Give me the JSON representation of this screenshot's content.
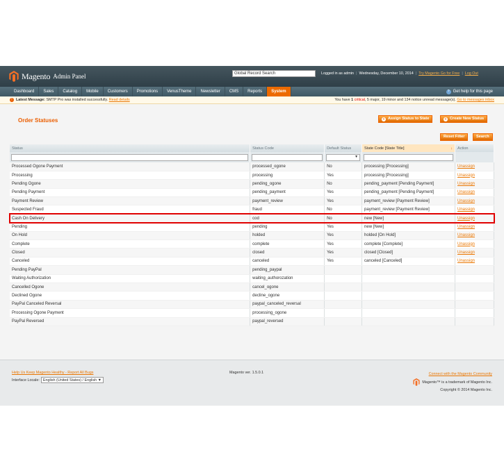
{
  "header": {
    "logo_text": "Magento",
    "logo_sub": "Admin Panel",
    "search_placeholder": "Global Record Search",
    "logged_in": "Logged in as admin",
    "date": "Wednesday, December 10, 2014",
    "try_link": "Try Magento Go for Free",
    "logout": "Log Out"
  },
  "nav": {
    "items": [
      "Dashboard",
      "Sales",
      "Catalog",
      "Mobile",
      "Customers",
      "Promotions",
      "VenusTheme",
      "Newsletter",
      "CMS",
      "Reports",
      "System"
    ],
    "active": "System",
    "help": "Get help for this page"
  },
  "message": {
    "label": "Latest Message:",
    "text": "SMTP Pro was installed successfully.",
    "link": "Read details",
    "right_prefix": "You have",
    "critical_count": "1",
    "critical_word": "critical",
    "rest": ", 5 major, 19 minor and 134 notice unread message(s).",
    "inbox_link": "Go to messages inbox"
  },
  "page": {
    "title": "Order Statuses",
    "assign_button": "Assign Status to State",
    "create_button": "Create New Status",
    "reset_button": "Reset Filter",
    "search_button": "Search"
  },
  "grid": {
    "columns": [
      "Status",
      "Status Code",
      "Default Status",
      "State Code [State Title]",
      "Action"
    ],
    "default_filter": "▼",
    "rows": [
      [
        "Processed Ogone Payment",
        "processed_ogone",
        "No",
        "processing [Processing]",
        "Unassign"
      ],
      [
        "Processing",
        "processing",
        "Yes",
        "processing [Processing]",
        "Unassign"
      ],
      [
        "Pending Ogone",
        "pending_ogone",
        "No",
        "pending_payment [Pending Payment]",
        "Unassign"
      ],
      [
        "Pending Payment",
        "pending_payment",
        "Yes",
        "pending_payment [Pending Payment]",
        "Unassign"
      ],
      [
        "Payment Review",
        "payment_review",
        "Yes",
        "payment_review [Payment Review]",
        "Unassign"
      ],
      [
        "Suspected Fraud",
        "fraud",
        "No",
        "payment_review [Payment Review]",
        "Unassign"
      ],
      [
        "Cash On Delivery",
        "cod",
        "No",
        "new [New]",
        "Unassign"
      ],
      [
        "Pending",
        "pending",
        "Yes",
        "new [New]",
        "Unassign"
      ],
      [
        "On Hold",
        "holded",
        "Yes",
        "holded [On Hold]",
        "Unassign"
      ],
      [
        "Complete",
        "complete",
        "Yes",
        "complete [Complete]",
        "Unassign"
      ],
      [
        "Closed",
        "closed",
        "Yes",
        "closed [Closed]",
        "Unassign"
      ],
      [
        "Canceled",
        "canceled",
        "Yes",
        "canceled [Canceled]",
        "Unassign"
      ],
      [
        "Pending PayPal",
        "pending_paypal",
        "",
        "",
        ""
      ],
      [
        "Waiting Authorization",
        "waiting_authorozation",
        "",
        "",
        ""
      ],
      [
        "Cancelled Ogone",
        "cancel_ogone",
        "",
        "",
        ""
      ],
      [
        "Declined Ogone",
        "decline_ogone",
        "",
        "",
        ""
      ],
      [
        "PayPal Canceled Reversal",
        "paypal_canceled_reversal",
        "",
        "",
        ""
      ],
      [
        "Processing Ogone Payment",
        "processing_ogone",
        "",
        "",
        ""
      ],
      [
        "PayPal Reversed",
        "paypal_reversed",
        "",
        "",
        ""
      ]
    ],
    "highlighted_row": "Cash On Delivery"
  },
  "footer": {
    "bug_link": "Help Us Keep Magento Healthy - Report All Bugs",
    "locale_label": "Interface Locale:",
    "locale_value": "English (United States) / English",
    "version": "Magento ver. 1.5.0.1",
    "community_link": "Connect with the Magento Community",
    "trademark": "Magento™ is a trademark of Magento Inc.",
    "copyright": "Copyright © 2014 Magento Inc."
  },
  "colors": {
    "accent": "#eb5e00",
    "header": "#3b4f59",
    "highlight": "#e00000"
  }
}
